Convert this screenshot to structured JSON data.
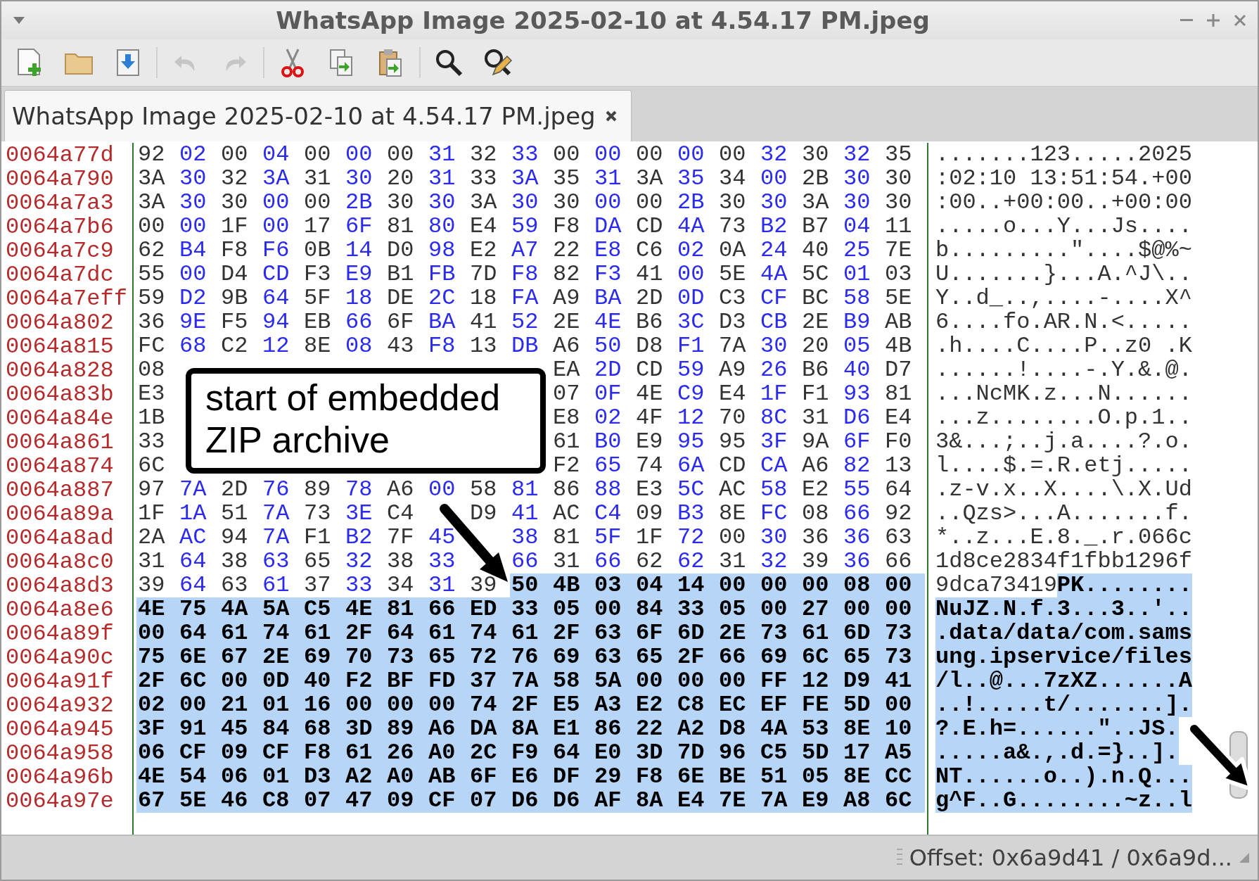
{
  "window": {
    "title": "WhatsApp Image 2025-02-10 at 4.54.17 PM.jpeg"
  },
  "toolbar": {
    "groups": [
      [
        {
          "kind": "new",
          "disabled": false
        },
        {
          "kind": "open",
          "disabled": false
        },
        {
          "kind": "save",
          "disabled": false
        }
      ],
      [
        {
          "kind": "undo",
          "disabled": true
        },
        {
          "kind": "redo",
          "disabled": true
        }
      ],
      [
        {
          "kind": "cut",
          "disabled": false
        },
        {
          "kind": "copy",
          "disabled": false
        },
        {
          "kind": "paste",
          "disabled": false
        }
      ],
      [
        {
          "kind": "find",
          "disabled": false
        },
        {
          "kind": "replace",
          "disabled": false
        }
      ]
    ]
  },
  "tabs": [
    {
      "label": "WhatsApp Image 2025-02-10 at 4.54.17 PM.jpeg",
      "selected": true
    }
  ],
  "hex_view": {
    "rows": [
      {
        "offset": "0064a77d",
        "hex": "92 02 00 04 00 00 00 31 32 33 00 00 00 00 00 32 30 32 35",
        "ascii": ".......123.....2025"
      },
      {
        "offset": "0064a790",
        "hex": "3A 30 32 3A 31 30 20 31 33 3A 35 31 3A 35 34 00 2B 30 30",
        "ascii": ":02:10 13:51:54.+00"
      },
      {
        "offset": "0064a7a3",
        "hex": "3A 30 30 00 00 2B 30 30 3A 30 30 00 00 2B 30 30 3A 30 30",
        "ascii": ":00..+00:00..+00:00"
      },
      {
        "offset": "0064a7b6",
        "hex": "00 00 1F 00 17 6F 81 80 E4 59 F8 DA CD 4A 73 B2 B7 04 11",
        "ascii": ".....o...Y...Js...."
      },
      {
        "offset": "0064a7c9",
        "hex": "62 B4 F8 F6 0B 14 D0 98 E2 A7 22 E8 C6 02 0A 24 40 25 7E",
        "ascii": "b.........\"....$@%~"
      },
      {
        "offset": "0064a7dc",
        "hex": "55 00 D4 CD F3 E9 B1 FB 7D F8 82 F3 41 00 5E 4A 5C 01 03",
        "ascii": "U.......}...A.^J\\.."
      },
      {
        "offset": "0064a7eff",
        "hex": "59 D2 9B 64 5F 18 DE 2C 18 FA A9 BA 2D 0D C3 CF BC 58 5E",
        "ascii": "Y..d_..,....-....X^"
      },
      {
        "offset": "0064a802",
        "hex": "36 9E F5 94 EB 66 6F BA 41 52 2E 4E B6 3C D3 CB 2E B9 AB",
        "ascii": "6....fo.AR.N.<....."
      },
      {
        "offset": "0064a815",
        "hex": "FC 68 C2 12 8E 08 43 F8 13 DB A6 50 D8 F1 7A 30 20 05 4B",
        "ascii": ".h....C....P..z0 .K"
      },
      {
        "offset": "0064a828",
        "hex": "08",
        "hex_after": "EA 2D CD 59 A9 26 B6 40 D7",
        "ascii": "......!....-.Y.&.@."
      },
      {
        "offset": "0064a83b",
        "hex": "E3",
        "hex_after": "07 0F 4E C9 E4 1F F1 93 81",
        "ascii": "...NcMK.z...N......"
      },
      {
        "offset": "0064a84e",
        "hex": "1B",
        "hex_after": "E8 02 4F 12 70 8C 31 D6 E4",
        "ascii": "...z........O.p.1.."
      },
      {
        "offset": "0064a861",
        "hex": "33",
        "hex_after": "61 B0 E9 95 95 3F 9A 6F F0",
        "ascii": "3&...;..j.a....?.o."
      },
      {
        "offset": "0064a874",
        "hex": "6C",
        "hex_after": "F2 65 74 6A CD CA A6 82 13",
        "ascii": "l....$.=.R.etj....."
      },
      {
        "offset": "0064a887",
        "hex": "97 7A 2D 76 89 78 A6 00 58 81 86 88 E3 5C AC 58 E2 55 64",
        "ascii": ".z-v.x..X....\\.X.Ud"
      },
      {
        "offset": "0064a89a",
        "hex": "1F 1A 51 7A 73 3E C4",
        "hex_after": "D9 41 AC C4 09 B3 8E FC 08 66 92",
        "ascii": "..Qzs>...A.......f."
      },
      {
        "offset": "0064a8ad",
        "hex": "2A AC 94 7A F1 B2 7F 45",
        "hex_after": "38 81 5F 1F 72 00 30 36 36 63",
        "ascii": "*..z...E.8._.r.066c"
      },
      {
        "offset": "0064a8c0",
        "hex": "31 64 38 63 65 32 38 33",
        "hex_after": "66 31 66 62 62 31 32 39 36 66",
        "ascii": "1d8ce2834f1fbb1296f"
      },
      {
        "offset": "0064a8d3",
        "hex": "39 64 63 61 37 33 34 31 39",
        "hex_selected": "50 4B 03 04 14 00 00 00 08 00",
        "ascii": "9dca73419",
        "ascii_selected": "PK........"
      },
      {
        "offset": "0064a8e6",
        "hex_selected": "4E 75 4A 5A C5 4E 81 66 ED 33 05 00 84 33 05 00 27 00 00",
        "ascii_selected": "NuJZ.N.f.3...3..'.."
      },
      {
        "offset": "0064a89f",
        "hex_selected": "00 64 61 74 61 2F 64 61 74 61 2F 63 6F 6D 2E 73 61 6D 73",
        "ascii_selected": ".data/data/com.sams"
      },
      {
        "offset": "0064a90c",
        "hex_selected": "75 6E 67 2E 69 70 73 65 72 76 69 63 65 2F 66 69 6C 65 73",
        "ascii_selected": "ung.ipservice/files"
      },
      {
        "offset": "0064a91f",
        "hex_selected": "2F 6C 00 0D 40 F2 BF FD 37 7A 58 5A 00 00 00 FF 12 D9 41",
        "ascii_selected": "/l..@...7zXZ......A"
      },
      {
        "offset": "0064a932",
        "hex_selected": "02 00 21 01 16 00 00 00 74 2F E5 A3 E2 C8 EC EF FE 5D 00",
        "ascii_selected": "..!.....t/.......]."
      },
      {
        "offset": "0064a945",
        "hex_selected": "3F 91 45 84 68 3D 89 A6 DA 8A E1 86 22 A2 D8 4A 53 8E 10",
        "ascii_selected": "?.E.h=......\"..JS."
      },
      {
        "offset": "0064a958",
        "hex_selected": "06 CF 09 CF F8 61 26 A0 2C F9 64 E0 3D 7D 96 C5 5D 17 A5",
        "ascii_selected": ".....a&.,.d.=}..]."
      },
      {
        "offset": "0064a96b",
        "hex_selected": "4E 54 06 01 D3 A2 A0 AB 6F E6 DF 29 F8 6E BE 51 05 8E CC",
        "ascii_selected": "NT......o..).n.Q..."
      },
      {
        "offset": "0064a97e",
        "hex_selected": "67 5E 46 C8 07 47 09 CF 07 D6 D6 AF 8A E4 7E 7A E9 A8 6C",
        "ascii_selected": "g^F..G........~z..l"
      }
    ]
  },
  "callout": {
    "text": "start of embedded ZIP archive"
  },
  "status_bar": {
    "text": "Offset: 0x6a9d41 / 0x6a9d..."
  }
}
